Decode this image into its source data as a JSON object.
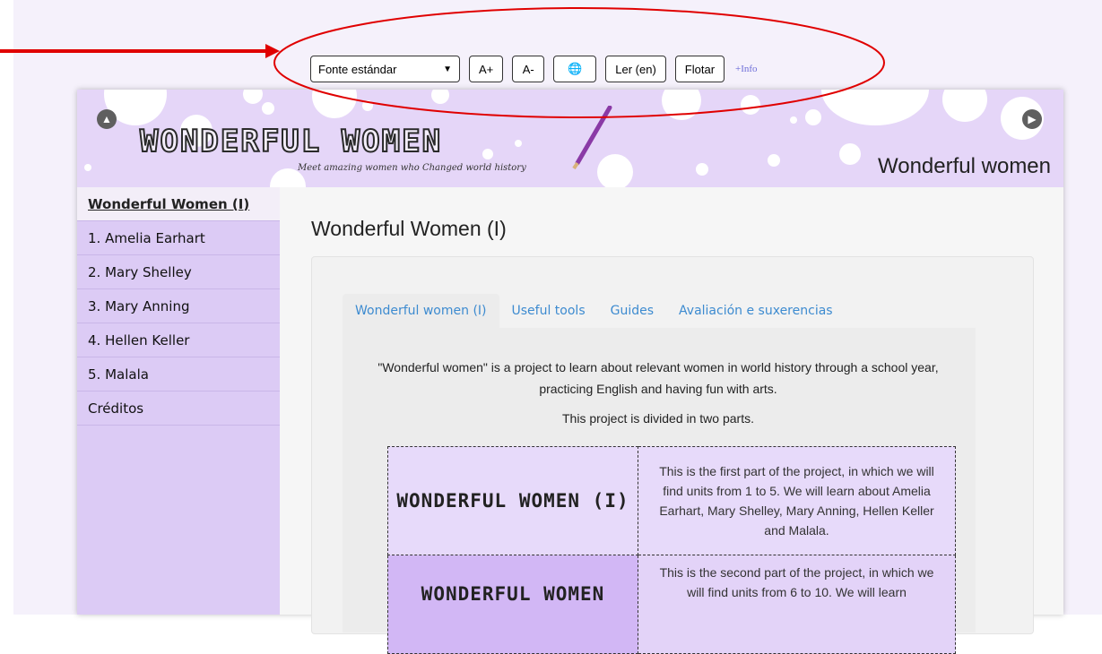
{
  "toolbar": {
    "font_select_value": "Fonte estándar",
    "increase_font_label": "A+",
    "decrease_font_label": "A-",
    "translate_icon": "globe-icon",
    "read_label": "Ler (en)",
    "float_label": "Flotar",
    "info_link": "+Info"
  },
  "banner": {
    "logo_title": "WONDERFUL WOMEN",
    "logo_subtitle": "Meet amazing women who Changed world history",
    "site_title": "Wonderful women",
    "prev_icon": "chevron-up-icon",
    "next_icon": "chevron-right-icon"
  },
  "sidebar": {
    "items": [
      {
        "label": "Wonderful Women (I)"
      },
      {
        "label": "1. Amelia Earhart"
      },
      {
        "label": "2. Mary Shelley"
      },
      {
        "label": "3. Mary Anning"
      },
      {
        "label": "4. Hellen Keller"
      },
      {
        "label": "5. Malala"
      },
      {
        "label": "Créditos"
      }
    ]
  },
  "main": {
    "title": "Wonderful Women (I)",
    "tabs": [
      {
        "label": "Wonderful women (I)"
      },
      {
        "label": "Useful tools"
      },
      {
        "label": "Guides"
      },
      {
        "label": "Avaliación e suxerencias"
      }
    ],
    "intro": "\"Wonderful women\" is a project to learn about relevant women in world history through a school year, practicing English and having fun with arts.",
    "divided": "This project is divided in two parts.",
    "parts": [
      {
        "title": "WONDERFUL WOMEN (I)",
        "text": "This is the first part of the project, in which we will find units from 1 to 5. We will learn about Amelia Earhart, Mary Shelley, Mary Anning, Hellen Keller and Malala."
      },
      {
        "title": "WONDERFUL WOMEN",
        "text": "This is the second part of the project, in which we will find units from 6 to 10. We will learn"
      }
    ]
  },
  "colors": {
    "annotation": "#e00000",
    "sidebar": "#dccbf5",
    "link": "#3d8bd0"
  }
}
